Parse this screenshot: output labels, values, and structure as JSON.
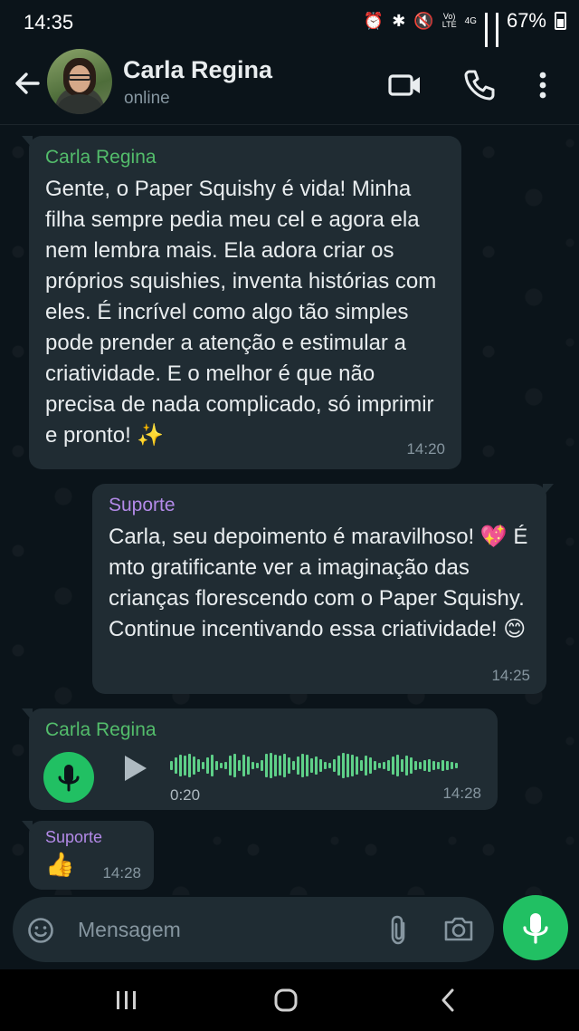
{
  "status_bar": {
    "time": "14:35",
    "battery": "67%",
    "network_label_1": "Vo)",
    "network_label_2": "LTE",
    "network_label_3": "4G"
  },
  "header": {
    "contact_name": "Carla Regina",
    "contact_status": "online",
    "icons": [
      "back-arrow-icon",
      "video-call-icon",
      "phone-icon",
      "more-vert-icon"
    ]
  },
  "messages": [
    {
      "sender": "Carla Regina",
      "text": "Gente, o Paper Squishy é vida! Minha filha sempre pedia meu cel e agora ela nem lembra mais. Ela adora criar os próprios squishies, inventa histórias com eles. É incrível como algo tão simples pode prender a atenção e estimular a criatividade. E o melhor é que não precisa de nada complicado, só imprimir e pronto! ✨",
      "time": "14:20"
    },
    {
      "sender": "Suporte",
      "text": "Carla, seu depoimento é maravilhoso! 💖 É mto gratificante ver a imaginação das crianças florescendo com o Paper Squishy. Continue incentivando essa criatividade! 😊",
      "time": "14:25"
    },
    {
      "sender": "Carla Regina",
      "type": "voice",
      "duration": "0:20",
      "time": "14:28"
    },
    {
      "sender": "Suporte",
      "text": "👍",
      "time": "14:28"
    }
  ],
  "composer": {
    "placeholder": "Mensagem",
    "icons": [
      "emoji-icon",
      "attach-icon",
      "camera-icon",
      "mic-icon"
    ]
  },
  "colors": {
    "background": "#0b141a",
    "bubble": "#202c33",
    "accent_green": "#21c063",
    "sender_green": "#53bd6b",
    "sender_purple": "#b38ae8"
  }
}
